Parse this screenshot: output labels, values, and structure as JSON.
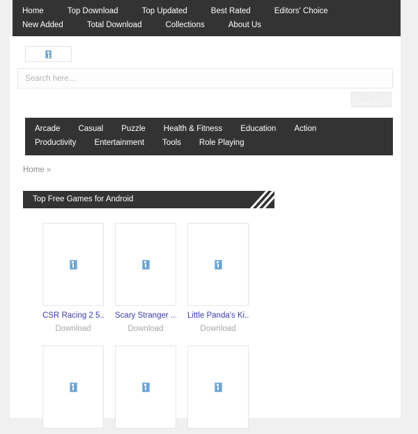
{
  "top_nav": {
    "items": [
      {
        "label": "Home"
      },
      {
        "label": "Top Download"
      },
      {
        "label": "Top Updated"
      },
      {
        "label": "Best Rated"
      },
      {
        "label": "Editors' Choice"
      },
      {
        "label": "New Added"
      },
      {
        "label": "Total Download"
      },
      {
        "label": "Collections"
      },
      {
        "label": "About Us"
      }
    ]
  },
  "header": {
    "logo_icon": "broken-image-icon"
  },
  "search": {
    "placeholder": "Search here...",
    "value": "",
    "button_label": "Search"
  },
  "category_nav": {
    "items": [
      {
        "label": "Arcade"
      },
      {
        "label": "Casual"
      },
      {
        "label": "Puzzle"
      },
      {
        "label": "Health & Fitness"
      },
      {
        "label": "Education"
      },
      {
        "label": "Action"
      },
      {
        "label": "Productivity"
      },
      {
        "label": "Entertainment"
      },
      {
        "label": "Tools"
      },
      {
        "label": "Role Playing"
      }
    ]
  },
  "breadcrumb": {
    "home_label": "Home",
    "separator": "»"
  },
  "section": {
    "title": "Top Free Games for Android",
    "ribbon_icon": "diagonal-stripes-icon"
  },
  "games": {
    "download_label": "Download",
    "thumb_icon": "broken-image-icon",
    "row1": [
      {
        "title": "CSR Racing 2 5....",
        "download": "Download"
      },
      {
        "title": "Scary Stranger ...",
        "download": "Download"
      },
      {
        "title": "Little Panda's Ki...",
        "download": "Download"
      }
    ],
    "row2": [
      {
        "title": "",
        "download": ""
      },
      {
        "title": "",
        "download": ""
      },
      {
        "title": "",
        "download": ""
      }
    ]
  },
  "colors": {
    "nav_background": "#333333",
    "page_background": "#f0f0f0",
    "content_background": "#ffffff",
    "link_blue": "#3b3bb3",
    "muted_gray": "#a8a8a8",
    "icon_blue": "#6aa5d6"
  }
}
